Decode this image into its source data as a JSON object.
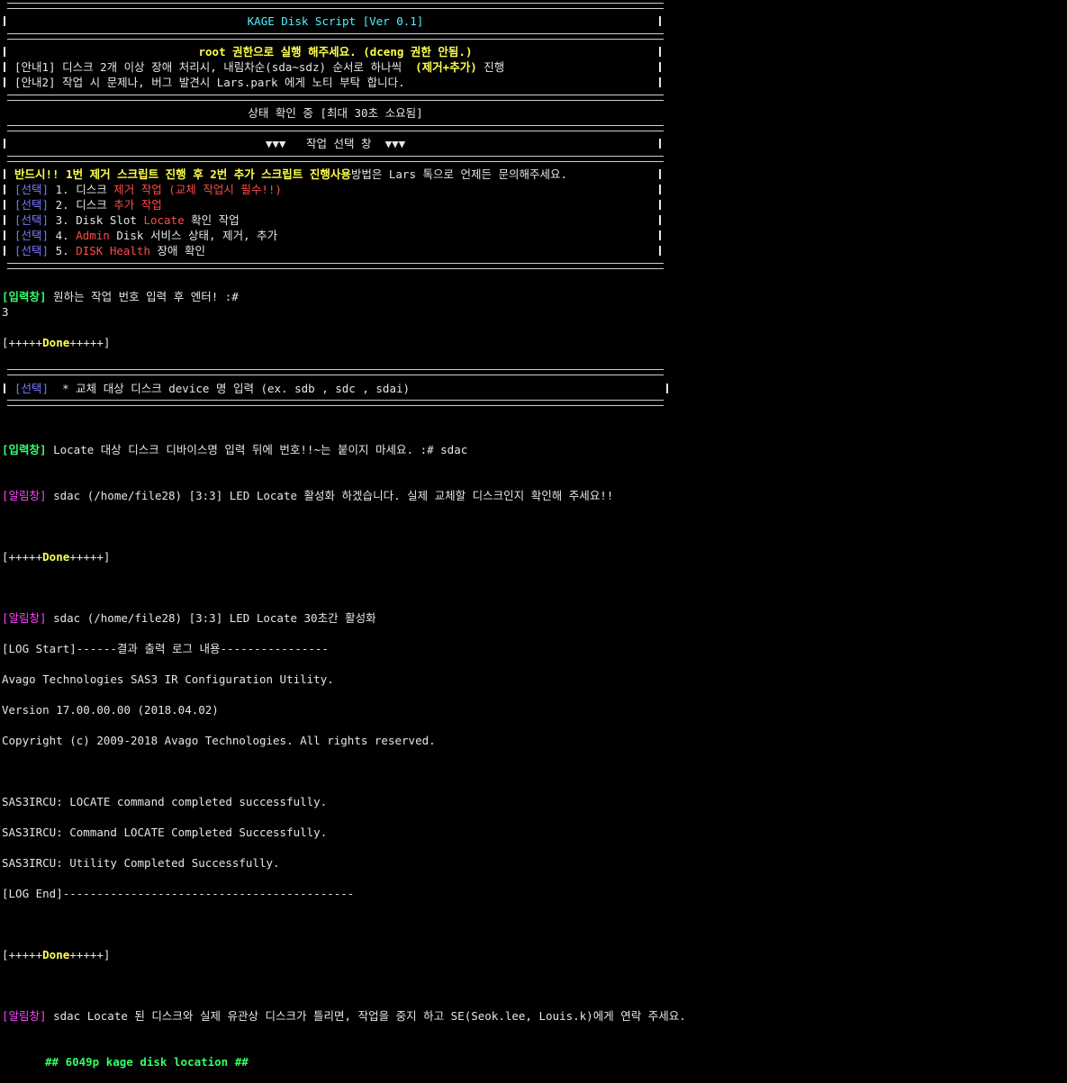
{
  "header": {
    "title": "KAGE Disk Script [Ver 0.1]"
  },
  "notice": {
    "root_warning": "root 권한으로 실행 해주세요. (dceng 권한 안됨.)",
    "info1_prefix": "[안내1] 디스크 2개 이상 장애 처리시, 내림차순(sda~sdz) 순서로 하나씩",
    "info1_highlight": "(제거+추가)",
    "info1_suffix": "진행",
    "info2": "[안내2] 작업 시 문제나, 버그 발견시 Lars.park 에게 노티 부탁 합니다."
  },
  "status_line": "상태 확인 중 [최대 30초 소요됨]",
  "menu": {
    "title": "▼▼▼   작업 선택 창  ▼▼▼",
    "warning_highlight": "반드시!! 1번 제거 스크립트 진행 후 2번 추가 스크립트 진행사용",
    "warning_suffix": "방법은 Lars 톡으로 언제든 문의해주세요.",
    "select_tag": "[선택]",
    "items": [
      {
        "num": "1.",
        "pre": "디스크",
        "hl": "제거 작업 (교체 작업시 필수!!)",
        "post": ""
      },
      {
        "num": "2.",
        "pre": "디스크",
        "hl": "추가 작업",
        "post": ""
      },
      {
        "num": "3.",
        "pre": "Disk Slot",
        "hl": "Locate",
        "post": "확인 작업"
      },
      {
        "num": "4.",
        "pre": "",
        "hl": "Admin",
        "post": "Disk 서비스 상태, 제거, 추가"
      },
      {
        "num": "5.",
        "pre": "",
        "hl": "DISK Health",
        "post": "장애 확인"
      }
    ]
  },
  "input1": {
    "tag": "[입력창]",
    "prompt": "원하는 작업 번호 입력 후 엔터! :#",
    "value": "3"
  },
  "done": {
    "open": "[+++++",
    "word": "Done",
    "close": "+++++]"
  },
  "device_box": {
    "tag": "[선택]",
    "text": "  * 교체 대상 디스크 device 명 입력 (ex. sdb , sdc , sdai)"
  },
  "input2": {
    "tag": "[입력창]",
    "prompt": "Locate 대상 디스크 디바이스명 입력 뒤에 번호!!~는 붙이지 마세요. :# sdac"
  },
  "alert_tag": "[알림창]",
  "alert1": " sdac (/home/file28) [3:3] LED Locate 활성화 하겠습니다. 실제 교체할 디스크인지 확인해 주세요!!",
  "alert2": " sdac (/home/file28) [3:3] LED Locate 30초간 활성화",
  "log": {
    "start": "[LOG Start]------결과 출력 로그 내용----------------",
    "line1": "Avago Technologies SAS3 IR Configuration Utility.",
    "line2": "Version 17.00.00.00 (2018.04.02)",
    "line3": "Copyright (c) 2009-2018 Avago Technologies. All rights reserved.",
    "line4": "SAS3IRCU: LOCATE command completed successfully.",
    "line5": "SAS3IRCU: Command LOCATE Completed Successfully.",
    "line6": "SAS3IRCU: Utility Completed Successfully.",
    "end": "[LOG End]-------------------------------------------"
  },
  "alert3": " sdac Locate 된 디스크와 실제 유관상 디스크가 틀리면, 작업을 중지 하고 SE(Seok.lee, Louis.k)에게 연락 주세요.",
  "footer_heading": "## 6049p kage disk location ##",
  "colors": {
    "background": "#000000",
    "cyan": "#4ff2ff",
    "yellow": "#ffff4d",
    "red": "#ff4a4a",
    "blue": "#7a7aff",
    "green": "#33ff66",
    "magenta": "#ff40ff"
  }
}
